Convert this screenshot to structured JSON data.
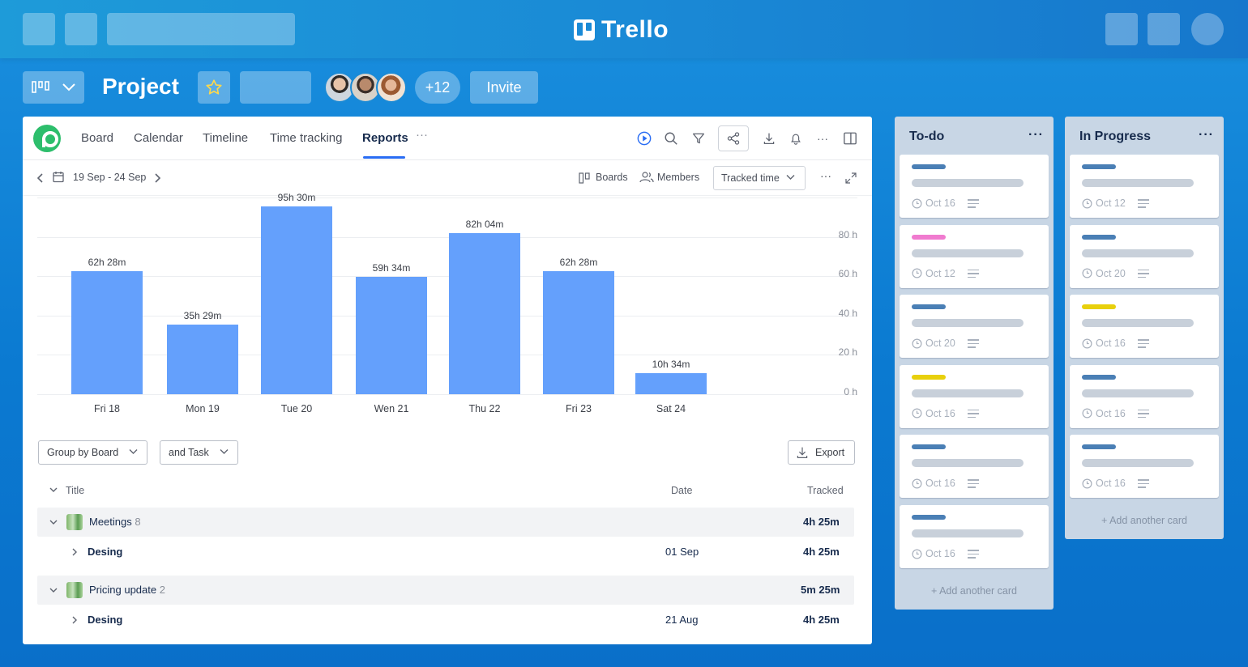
{
  "app": {
    "name": "Trello"
  },
  "board": {
    "title": "Project",
    "members_extra": "+12",
    "invite_label": "Invite"
  },
  "nav": {
    "tabs": [
      {
        "label": "Board"
      },
      {
        "label": "Calendar"
      },
      {
        "label": "Timeline"
      },
      {
        "label": "Time tracking"
      },
      {
        "label": "Reports",
        "active": true
      }
    ],
    "more": "···"
  },
  "report": {
    "date_range": "19 Sep - 24 Sep",
    "boards_label": "Boards",
    "members_label": "Members",
    "metric_selected": "Tracked time",
    "more": "···"
  },
  "chart_data": {
    "type": "bar",
    "categories": [
      "Fri 18",
      "Mon 19",
      "Tue 20",
      "Wen 21",
      "Thu 22",
      "Fri 23",
      "Sat 24"
    ],
    "values": [
      62.47,
      35.48,
      95.5,
      59.57,
      82.07,
      62.47,
      10.57
    ],
    "data_labels": [
      "62h 28m",
      "35h 29m",
      "95h 30m",
      "59h 34m",
      "82h 04m",
      "62h 28m",
      "10h 34m"
    ],
    "y_ticks": [
      "80 h",
      "60 h",
      "40 h",
      "20 h",
      "0 h"
    ],
    "y_tick_values": [
      80,
      60,
      40,
      20,
      0
    ],
    "ylim": [
      0,
      100
    ],
    "grid": true,
    "color": "#64a0fc"
  },
  "controls": {
    "group_by": "Group by Board",
    "then_by": "and Task",
    "export_label": "Export"
  },
  "table": {
    "headers": {
      "title": "Title",
      "date": "Date",
      "tracked": "Tracked"
    },
    "groups": [
      {
        "name": "Meetings",
        "count": "8",
        "tracked": "4h 25m",
        "rows": [
          {
            "name": "Desing",
            "date": "01 Sep",
            "tracked": "4h 25m"
          }
        ]
      },
      {
        "name": "Pricing update",
        "count": "2",
        "tracked": "5m 25m",
        "rows": [
          {
            "name": "Desing",
            "date": "21 Aug",
            "tracked": "4h 25m"
          }
        ]
      }
    ]
  },
  "lists": [
    {
      "title": "To-do",
      "add_label": "+ Add another card",
      "cards": [
        {
          "label_color": "#4a7fb5",
          "date": "Oct 16"
        },
        {
          "label_color": "#f07bcf",
          "date": "Oct 12"
        },
        {
          "label_color": "#4a7fb5",
          "date": "Oct 20"
        },
        {
          "label_color": "#e8d00c",
          "date": "Oct 16"
        },
        {
          "label_color": "#4a7fb5",
          "date": "Oct 16"
        },
        {
          "label_color": "#4a7fb5",
          "date": "Oct 16"
        }
      ]
    },
    {
      "title": "In Progress",
      "add_label": "+ Add another card",
      "cards": [
        {
          "label_color": "#4a7fb5",
          "date": "Oct 12"
        },
        {
          "label_color": "#4a7fb5",
          "date": "Oct 20"
        },
        {
          "label_color": "#e8d00c",
          "date": "Oct 16"
        },
        {
          "label_color": "#4a7fb5",
          "date": "Oct 16"
        },
        {
          "label_color": "#4a7fb5",
          "date": "Oct 16"
        }
      ]
    }
  ]
}
